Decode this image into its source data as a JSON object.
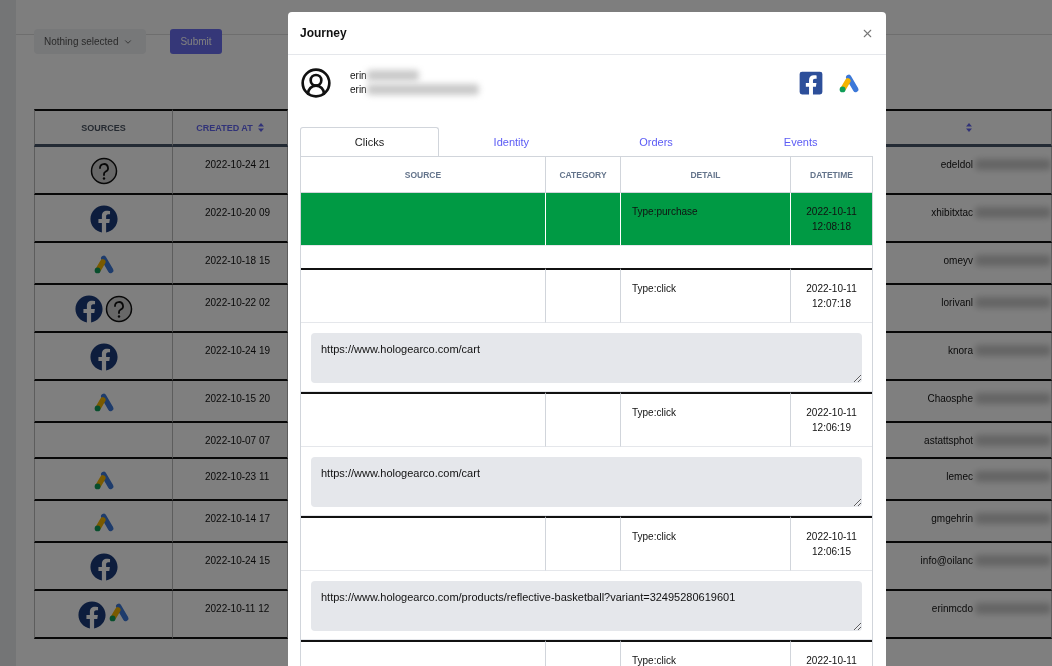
{
  "page": {
    "filter": {
      "placeholder": "Nothing selected"
    },
    "submit": "Submit"
  },
  "table": {
    "columns": [
      {
        "label": "SOURCES",
        "sortable": false
      },
      {
        "label": "CREATED AT",
        "sortable": true
      },
      {
        "sortable": true
      }
    ],
    "rows": [
      {
        "sources": [
          {
            "kind": "unknown"
          }
        ],
        "created_at": "2022-10-24 21",
        "email": "edeldol"
      },
      {
        "sources": [
          {
            "kind": "facebook"
          }
        ],
        "created_at": "2022-10-20 09",
        "email": "xhibitxtac"
      },
      {
        "sources": [
          {
            "kind": "google-ads"
          }
        ],
        "created_at": "2022-10-18 15",
        "email": "omeyv"
      },
      {
        "sources": [
          {
            "kind": "facebook"
          },
          {
            "kind": "unknown"
          }
        ],
        "created_at": "2022-10-22 02",
        "email": "lorivanl"
      },
      {
        "sources": [
          {
            "kind": "facebook"
          }
        ],
        "created_at": "2022-10-24 19",
        "email": "knora"
      },
      {
        "sources": [
          {
            "kind": "google-ads"
          }
        ],
        "created_at": "2022-10-15 20",
        "email": "Chaosphe"
      },
      {
        "created_at": "2022-10-07 07",
        "email": "astattsphot"
      },
      {
        "sources": [
          {
            "kind": "google-ads"
          }
        ],
        "created_at": "2022-10-23 11",
        "email": "lemec"
      },
      {
        "sources": [
          {
            "kind": "google-ads"
          }
        ],
        "created_at": "2022-10-14 17",
        "email": "gmgehrin"
      },
      {
        "sources": [
          {
            "kind": "facebook"
          }
        ],
        "created_at": "2022-10-24 15",
        "email": "info@oilanc"
      },
      {
        "sources": [
          {
            "kind": "facebook"
          },
          {
            "kind": "google-ads"
          }
        ],
        "created_at": "2022-10-11 12",
        "email": "erinmcdo"
      }
    ]
  },
  "modal": {
    "title": "Journey",
    "user": {
      "name": "erin",
      "email": "erin"
    },
    "sources": [
      {
        "kind": "facebook"
      },
      {
        "kind": "google-ads"
      }
    ],
    "tabs": [
      {
        "label": "Clicks",
        "selected": true
      },
      {
        "label": "Identity",
        "selected": false
      },
      {
        "label": "Orders",
        "selected": false
      },
      {
        "label": "Events",
        "selected": false
      }
    ],
    "table": {
      "columns": [
        "SOURCE",
        "CATEGORY",
        "DETAIL",
        "DATETIME"
      ],
      "events": [
        {
          "highlighted": true,
          "detail": "Type:purchase",
          "datetime": "2022-10-11 12:08:18"
        },
        {
          "highlighted": false,
          "detail": "Type:click",
          "datetime": "2022-10-11 12:07:18",
          "url": "https://www.hologearco.com/cart"
        },
        {
          "highlighted": false,
          "detail": "Type:click",
          "datetime": "2022-10-11 12:06:19",
          "url": "https://www.hologearco.com/cart"
        },
        {
          "highlighted": false,
          "detail": "Type:click",
          "datetime": "2022-10-11 12:06:15",
          "url": "https://www.hologearco.com/products/reflective-basketball?variant=32495280619601"
        },
        {
          "highlighted": false,
          "detail": "Type:click",
          "datetime": "2022-10-11"
        }
      ]
    }
  }
}
